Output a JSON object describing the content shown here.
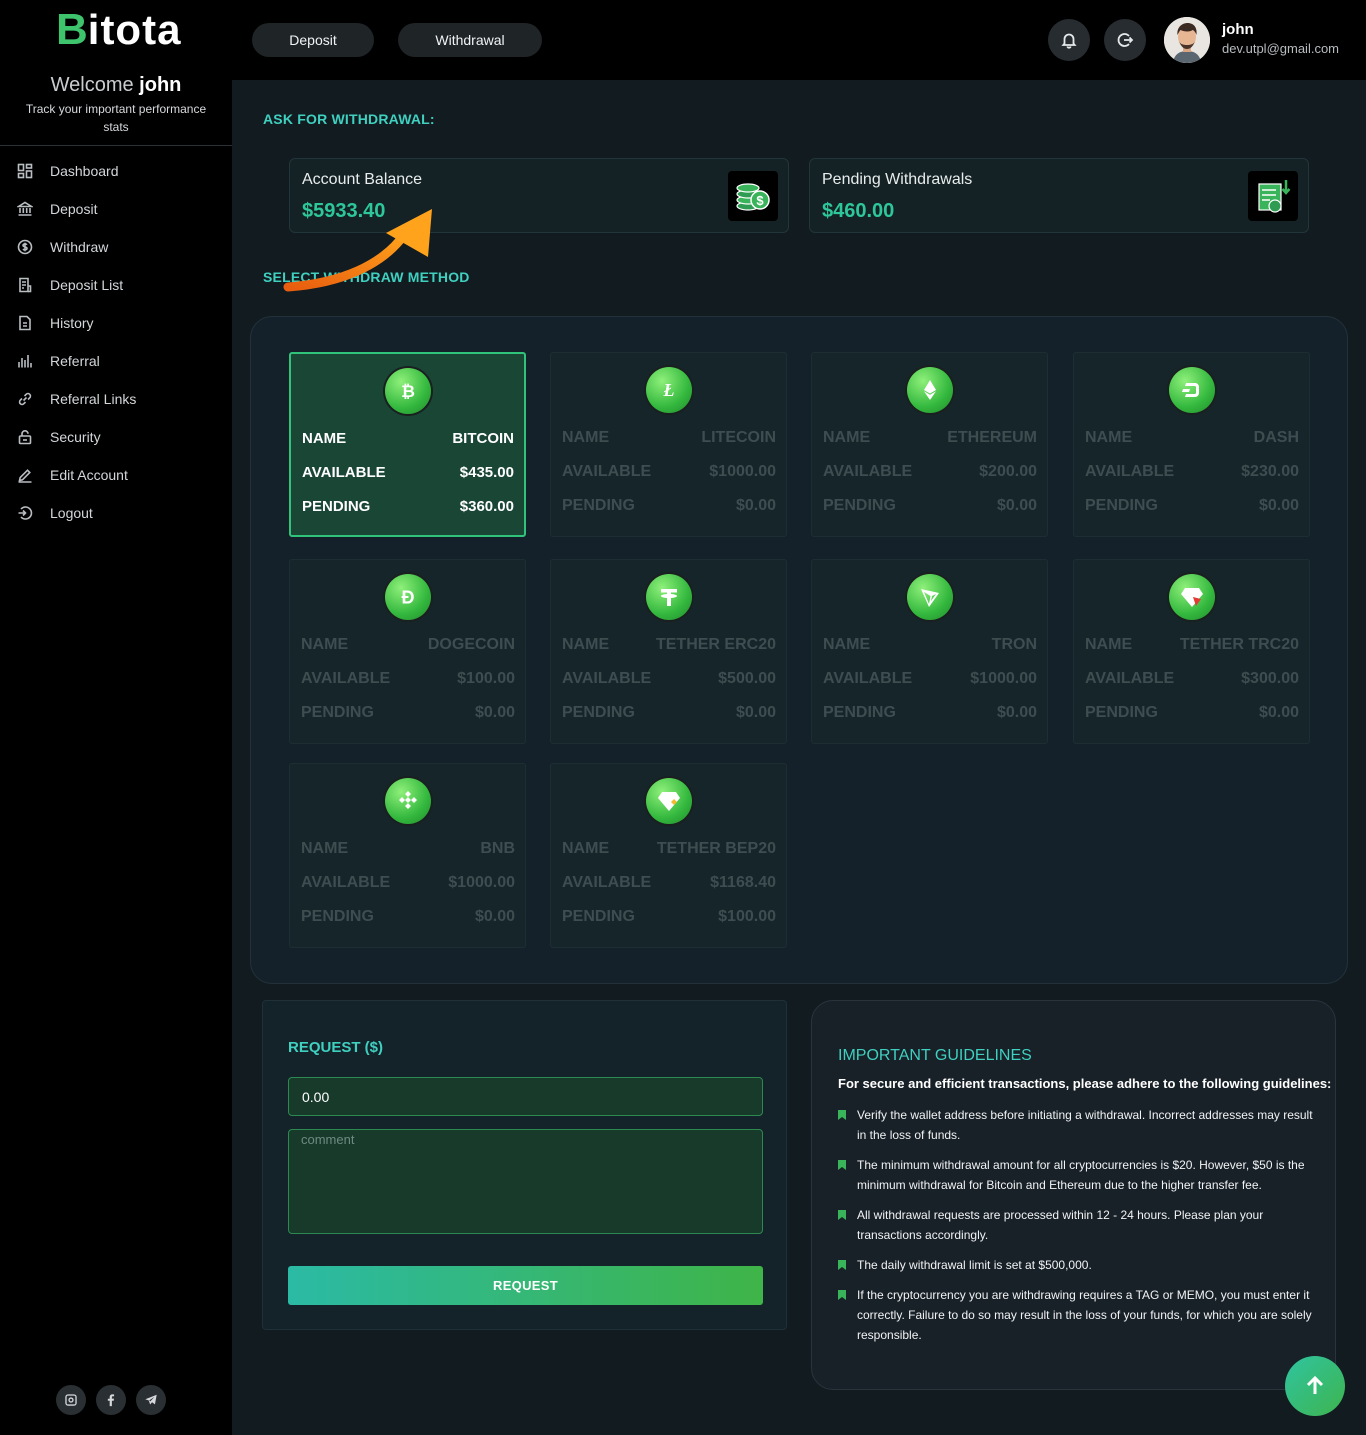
{
  "brand": {
    "first": "B",
    "rest": "itota"
  },
  "sidebar": {
    "welcome_prefix": "Welcome",
    "welcome_name": "john",
    "tagline": "Track your important performance stats",
    "items": [
      {
        "label": "Dashboard",
        "icon": "grid-icon"
      },
      {
        "label": "Deposit",
        "icon": "bank-icon"
      },
      {
        "label": "Withdraw",
        "icon": "dollar-circle-icon"
      },
      {
        "label": "Deposit List",
        "icon": "document-list-icon"
      },
      {
        "label": "History",
        "icon": "history-icon"
      },
      {
        "label": "Referral",
        "icon": "bar-chart-icon"
      },
      {
        "label": "Referral Links",
        "icon": "link-icon"
      },
      {
        "label": "Security",
        "icon": "lock-icon"
      },
      {
        "label": "Edit Account",
        "icon": "pencil-icon"
      },
      {
        "label": "Logout",
        "icon": "logout-icon"
      }
    ],
    "socials": [
      "instagram-icon",
      "facebook-icon",
      "telegram-icon"
    ]
  },
  "topbar": {
    "deposit_label": "Deposit",
    "withdrawal_label": "Withdrawal",
    "user_name": "john",
    "user_email": "dev.utpl@gmail.com"
  },
  "main": {
    "ask_title": "ASK FOR WITHDRAWAL:",
    "account_balance_label": "Account Balance",
    "account_balance_value": "$5933.40",
    "pending_withdrawals_label": "Pending Withdrawals",
    "pending_withdrawals_value": "$460.00",
    "select_title": "SELECT WITHDRAW METHOD",
    "field_labels": {
      "name": "NAME",
      "available": "AVAILABLE",
      "pending": "PENDING"
    },
    "methods": [
      {
        "name": "BITCOIN",
        "available": "$435.00",
        "pending": "$360.00",
        "icon": "bitcoin-icon",
        "selected": true
      },
      {
        "name": "LITECOIN",
        "available": "$1000.00",
        "pending": "$0.00",
        "icon": "litecoin-icon"
      },
      {
        "name": "ETHEREUM",
        "available": "$200.00",
        "pending": "$0.00",
        "icon": "ethereum-icon"
      },
      {
        "name": "DASH",
        "available": "$230.00",
        "pending": "$0.00",
        "icon": "dash-icon"
      },
      {
        "name": "DOGECOIN",
        "available": "$100.00",
        "pending": "$0.00",
        "icon": "dogecoin-icon"
      },
      {
        "name": "TETHER ERC20",
        "available": "$500.00",
        "pending": "$0.00",
        "icon": "tether-icon"
      },
      {
        "name": "TRON",
        "available": "$1000.00",
        "pending": "$0.00",
        "icon": "tron-icon"
      },
      {
        "name": "TETHER TRC20",
        "available": "$300.00",
        "pending": "$0.00",
        "icon": "tether-trc20-icon"
      },
      {
        "name": "BNB",
        "available": "$1000.00",
        "pending": "$0.00",
        "icon": "bnb-icon"
      },
      {
        "name": "TETHER BEP20",
        "available": "$1168.40",
        "pending": "$100.00",
        "icon": "tether-bep20-icon"
      }
    ]
  },
  "request": {
    "title": "REQUEST ($)",
    "amount_value": "0.00",
    "comment_placeholder": "comment",
    "button_label": "REQUEST"
  },
  "guidelines": {
    "title": "IMPORTANT GUIDELINES",
    "subtitle": "For secure and efficient transactions, please adhere to the following guidelines:",
    "items": [
      "Verify the wallet address before initiating a withdrawal. Incorrect addresses may result in the loss of funds.",
      "The minimum withdrawal amount for all cryptocurrencies is $20. However, $50 is the minimum withdrawal for Bitcoin and Ethereum due to the higher transfer fee.",
      "All withdrawal requests are processed within 12 - 24 hours. Please plan your transactions accordingly.",
      "The daily withdrawal limit is set at $500,000.",
      "If the cryptocurrency you are withdrawing requires a TAG or MEMO, you must enter it correctly. Failure to do so may result in the loss of your funds, for which you are solely responsible."
    ]
  },
  "colors": {
    "accent": "#3fd0c0",
    "green": "#2ec79a",
    "selected_card": "#1a4636"
  }
}
